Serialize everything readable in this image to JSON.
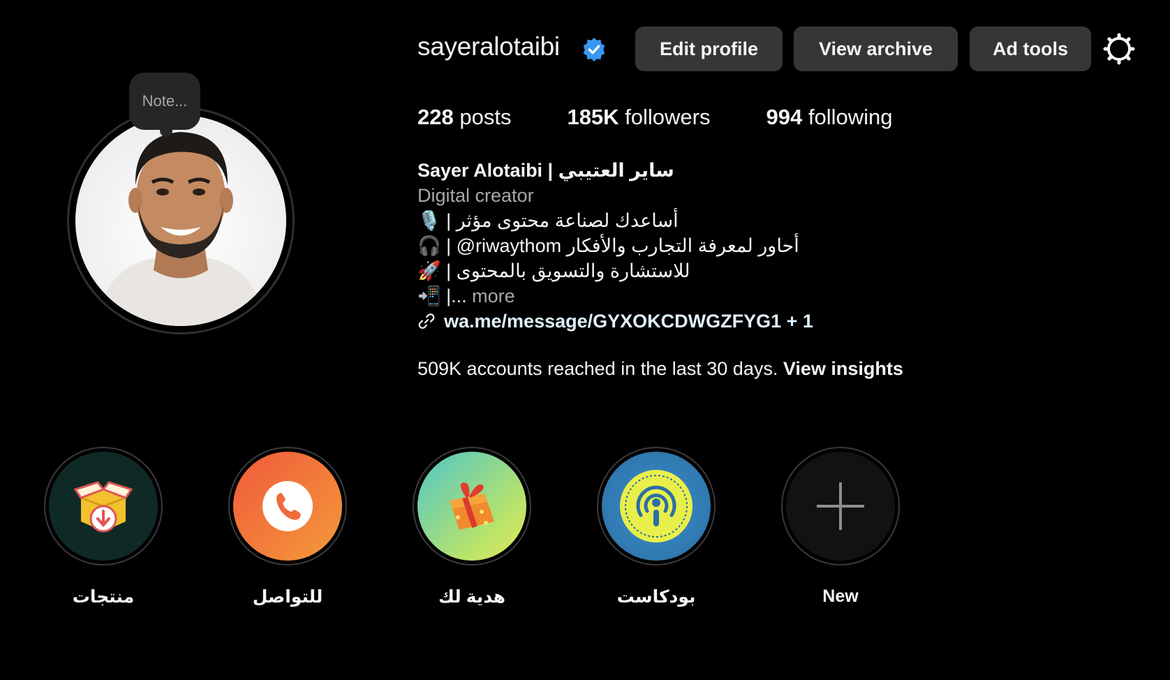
{
  "profile": {
    "username": "sayeralotaibi",
    "note_placeholder": "Note...",
    "verified_icon": "verified-badge-icon"
  },
  "actions": {
    "edit_profile": "Edit profile",
    "view_archive": "View archive",
    "ad_tools": "Ad tools"
  },
  "stats": {
    "posts_count": "228",
    "posts_label": " posts",
    "followers_count": "185K",
    "followers_label": " followers",
    "following_count": "994",
    "following_label": " following"
  },
  "bio": {
    "full_name": "Sayer Alotaibi | ساير العتيبي",
    "category": "Digital creator",
    "line1_emoji": "🎙️",
    "line1_text": " | أساعدك لصناعة محتوى مؤثر",
    "line2_emoji": "🎧",
    "line2_text": " | @riwaythom أحاور لمعرفة التجارب والأفكار",
    "line3_emoji": "🚀",
    "line3_text": " | للاستشارة والتسويق بالمحتوى",
    "line4_emoji": "📲",
    "line4_text": " |...",
    "more_label": " more",
    "link": "wa.me/message/GYXOKCDWGZFYG1 + 1"
  },
  "insights": {
    "reach_text": "509K accounts reached in the last 30 days. ",
    "view_insights": "View insights"
  },
  "highlights": [
    {
      "label": "منتجات",
      "icon": "product-box-icon",
      "bg": "#0f2a26"
    },
    {
      "label": "للتواصل",
      "icon": "phone-icon",
      "bg": "#f0713a"
    },
    {
      "label": "هدية لك",
      "icon": "gift-icon",
      "bg": "#7fd0a0"
    },
    {
      "label": "بودكاست",
      "icon": "podcast-icon",
      "bg": "#2c7bb5"
    },
    {
      "label": "New",
      "icon": "plus-icon",
      "bg": "#121212"
    }
  ],
  "colors": {
    "background": "#000000",
    "button": "#363636",
    "verified": "#3897f0",
    "muted_text": "#a8a8a8"
  }
}
